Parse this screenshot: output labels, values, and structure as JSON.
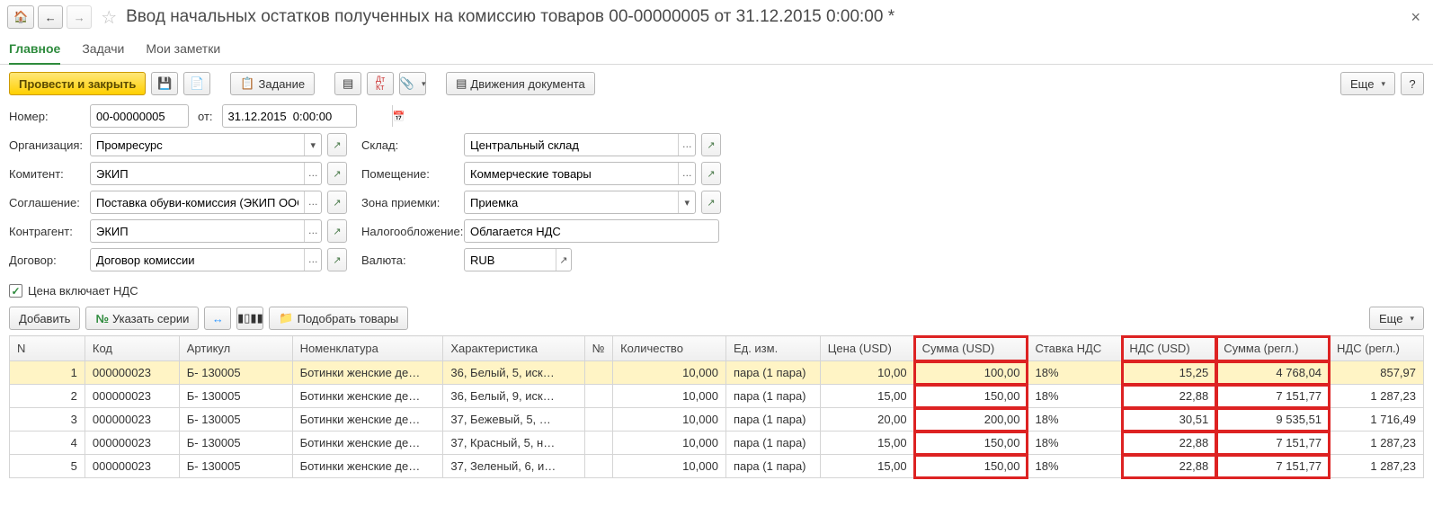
{
  "title": "Ввод начальных остатков полученных на комиссию товаров 00-00000005 от 31.12.2015 0:00:00 *",
  "tabs": {
    "main": "Главное",
    "tasks": "Задачи",
    "notes": "Мои заметки"
  },
  "toolbar": {
    "post_close": "Провести и закрыть",
    "task": "Задание",
    "movements": "Движения документа",
    "more": "Еще"
  },
  "form": {
    "number_lbl": "Номер:",
    "number": "00-00000005",
    "date_lbl": "от:",
    "date": "31.12.2015  0:00:00",
    "org_lbl": "Организация:",
    "org": "Промресурс",
    "warehouse_lbl": "Склад:",
    "warehouse": "Центральный склад",
    "principal_lbl": "Комитент:",
    "principal": "ЭКИП",
    "room_lbl": "Помещение:",
    "room": "Коммерческие товары",
    "agreement_lbl": "Соглашение:",
    "agreement": "Поставка обуви-комиссия (ЭКИП ООО)",
    "zone_lbl": "Зона приемки:",
    "zone": "Приемка",
    "counterparty_lbl": "Контрагент:",
    "counterparty": "ЭКИП",
    "tax_lbl": "Налогообложение:",
    "tax": "Облагается НДС",
    "contract_lbl": "Договор:",
    "contract": "Договор комиссии",
    "currency_lbl": "Валюта:",
    "currency": "RUB",
    "price_includes_vat": "Цена включает НДС"
  },
  "grid_toolbar": {
    "add": "Добавить",
    "series": "Указать серии",
    "pick": "Подобрать товары",
    "more": "Еще"
  },
  "columns": {
    "n": "N",
    "code": "Код",
    "art": "Артикул",
    "nom": "Номенклатура",
    "char": "Характеристика",
    "ns": "№",
    "qty": "Количество",
    "unit": "Ед. изм.",
    "price": "Цена (USD)",
    "sum": "Сумма (USD)",
    "rate": "Ставка НДС",
    "vat": "НДС (USD)",
    "sumr": "Сумма (регл.)",
    "vatr": "НДС (регл.)"
  },
  "rows": [
    {
      "n": "1",
      "code": "000000023",
      "art": "Б- 130005",
      "nom": "Ботинки женские де…",
      "char": "36, Белый, 5, иск…",
      "qty": "10,000",
      "unit": "пара (1 пара)",
      "price": "10,00",
      "sum": "100,00",
      "rate": "18%",
      "vat": "15,25",
      "sumr": "4 768,04",
      "vatr": "857,97"
    },
    {
      "n": "2",
      "code": "000000023",
      "art": "Б- 130005",
      "nom": "Ботинки женские де…",
      "char": "36, Белый, 9, иск…",
      "qty": "10,000",
      "unit": "пара (1 пара)",
      "price": "15,00",
      "sum": "150,00",
      "rate": "18%",
      "vat": "22,88",
      "sumr": "7 151,77",
      "vatr": "1 287,23"
    },
    {
      "n": "3",
      "code": "000000023",
      "art": "Б- 130005",
      "nom": "Ботинки женские де…",
      "char": "37, Бежевый, 5, …",
      "qty": "10,000",
      "unit": "пара (1 пара)",
      "price": "20,00",
      "sum": "200,00",
      "rate": "18%",
      "vat": "30,51",
      "sumr": "9 535,51",
      "vatr": "1 716,49"
    },
    {
      "n": "4",
      "code": "000000023",
      "art": "Б- 130005",
      "nom": "Ботинки женские де…",
      "char": "37, Красный, 5, н…",
      "qty": "10,000",
      "unit": "пара (1 пара)",
      "price": "15,00",
      "sum": "150,00",
      "rate": "18%",
      "vat": "22,88",
      "sumr": "7 151,77",
      "vatr": "1 287,23"
    },
    {
      "n": "5",
      "code": "000000023",
      "art": "Б- 130005",
      "nom": "Ботинки женские де…",
      "char": "37, Зеленый, 6, и…",
      "qty": "10,000",
      "unit": "пара (1 пара)",
      "price": "15,00",
      "sum": "150,00",
      "rate": "18%",
      "vat": "22,88",
      "sumr": "7 151,77",
      "vatr": "1 287,23"
    }
  ]
}
